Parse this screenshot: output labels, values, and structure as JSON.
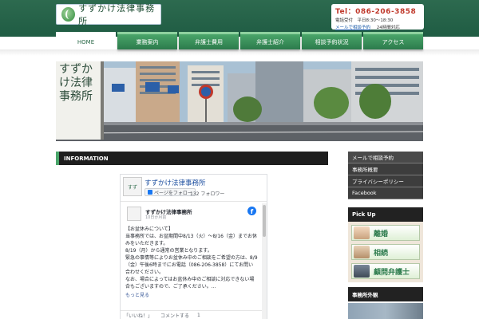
{
  "header": {
    "logo_text": "すずかけ法律事務所",
    "tel": "Tel：086-206-3858",
    "hours": "電話受付　平日8:30〜18:30",
    "mail_link": "メールで相談予約",
    "mail_note": "24時間対応",
    "tel_color": "#c0392b"
  },
  "nav": {
    "items": [
      {
        "label": "HOME",
        "active": true
      },
      {
        "label": "業務案内"
      },
      {
        "label": "弁護士費用"
      },
      {
        "label": "弁護士紹介"
      },
      {
        "label": "相談予約状況"
      },
      {
        "label": "アクセス"
      }
    ]
  },
  "hero": {
    "sign_text": "すずかけ法律事務所"
  },
  "information": {
    "title": "INFORMATION"
  },
  "facebook": {
    "page_name": "すずかけ法律事務所",
    "follow_button": "ページをフォロー",
    "followers": "132 フォロワー",
    "post_author": "すずかけ法律事務所",
    "post_time": "10日か月前",
    "post_lines": [
      "【お盆休みについて】",
      "当事務所では、お盆期間中8/13（火）〜8/16（金）までお休みをいただきます。",
      "8/19（月）から通常の営業となります。",
      "緊急の事情等によりお盆休み中のご相談をご希望の方は、8/9（金）午後6時までにお電話（086-206-3858）にてお問い合わせください。",
      "なお、場合によってはお盆休み中のご相談に対応できない場合もございますので、ご了承ください。..."
    ],
    "more": "もっと見る",
    "actions": [
      "「いいね！」",
      "コメントする",
      "1"
    ],
    "fb_logo": "f"
  },
  "sidebar": {
    "menu": [
      "メールで相談予約",
      "事務所概要",
      "プライバシーポリシー",
      "Facebook"
    ],
    "pickup_title": "Pick Up",
    "pickup_items": [
      "離婚",
      "相続",
      "顧問弁護士"
    ],
    "office_title": "事務所外観"
  }
}
